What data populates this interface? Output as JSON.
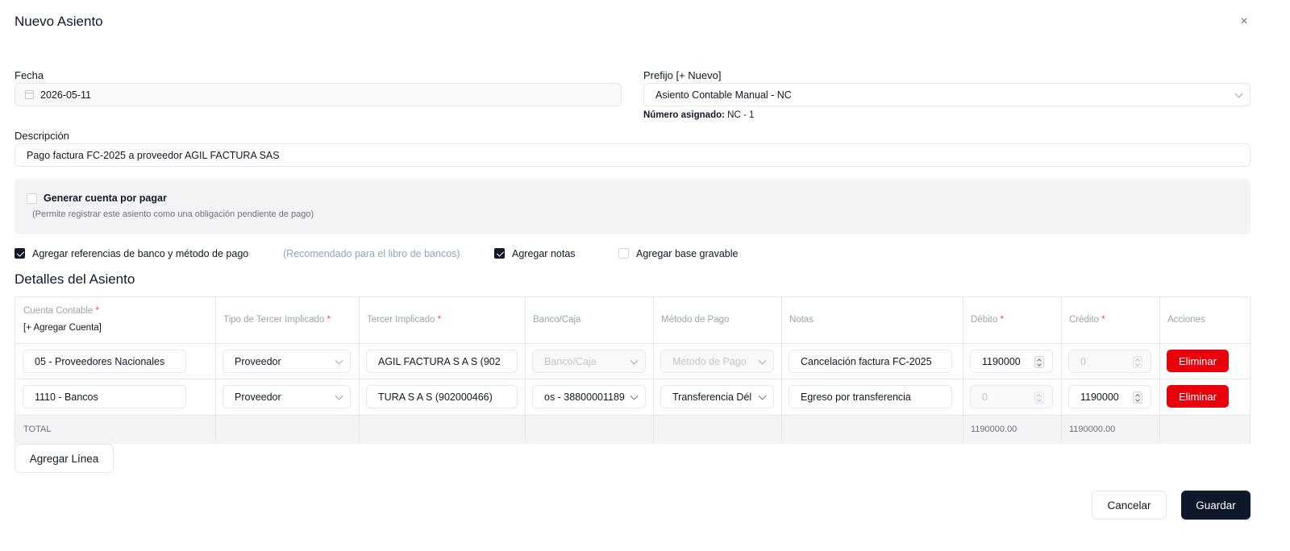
{
  "dialog": {
    "title": "Nuevo Asiento",
    "close_symbol": "×"
  },
  "form": {
    "fecha_label": "Fecha",
    "fecha_value": "2026-05-11",
    "prefijo_label": "Prefijo [+ Nuevo]",
    "prefijo_value": "Asiento Contable Manual - NC",
    "numero_asignado_label": "Número asignado:",
    "numero_asignado_value": "NC - 1",
    "descripcion_label": "Descripción",
    "descripcion_value": "Pago factura FC-2025 a proveedor AGIL FACTURA SAS"
  },
  "cxp": {
    "label": "Generar cuenta por pagar",
    "hint": "(Permite registrar este asiento como una obligación pendiente de pago)",
    "checked": false
  },
  "options": {
    "banco_label": "Agregar referencias de banco y método de pago",
    "banco_hint": "(Recomendado para el libro de bancos)",
    "banco_checked": true,
    "notas_label": "Agregar notas",
    "notas_checked": true,
    "base_label": "Agregar base gravable",
    "base_checked": false
  },
  "details": {
    "title": "Detalles del Asiento",
    "headers": {
      "cuenta": "Cuenta Contable",
      "agregar_cuenta": "[+ Agregar Cuenta]",
      "tipo_tercero": "Tipo de Tercer Implicado",
      "tercero": "Tercer Implicado",
      "banco": "Banco/Caja",
      "metodo": "Método de Pago",
      "notas": "Notas",
      "debito": "Débito",
      "credito": "Crédito",
      "acciones": "Acciones",
      "required_mark": "*"
    },
    "rows": [
      {
        "cuenta": "05 - Proveedores Nacionales",
        "tipo_tercero": "Proveedor",
        "tercero": "AGIL FACTURA S A S (902",
        "banco": "Banco/Caja",
        "metodo": "Método de Pago",
        "notas": "Cancelación factura FC-2025",
        "debito": "1190000",
        "credito": "0",
        "accion": "Eliminar"
      },
      {
        "cuenta": "1110 - Bancos",
        "tipo_tercero": "Proveedor",
        "tercero": "TURA S A S (902000466)",
        "banco": "os - 38800001189",
        "metodo": "Transferencia Dél",
        "notas": "Egreso por transferencia",
        "debito": "0",
        "credito": "1190000",
        "accion": "Eliminar"
      }
    ],
    "total_label": "TOTAL",
    "total_debito": "1190000.00",
    "total_credito": "1190000.00"
  },
  "actions": {
    "add_line": "Agregar Línea",
    "cancel": "Cancelar",
    "save": "Guardar"
  }
}
